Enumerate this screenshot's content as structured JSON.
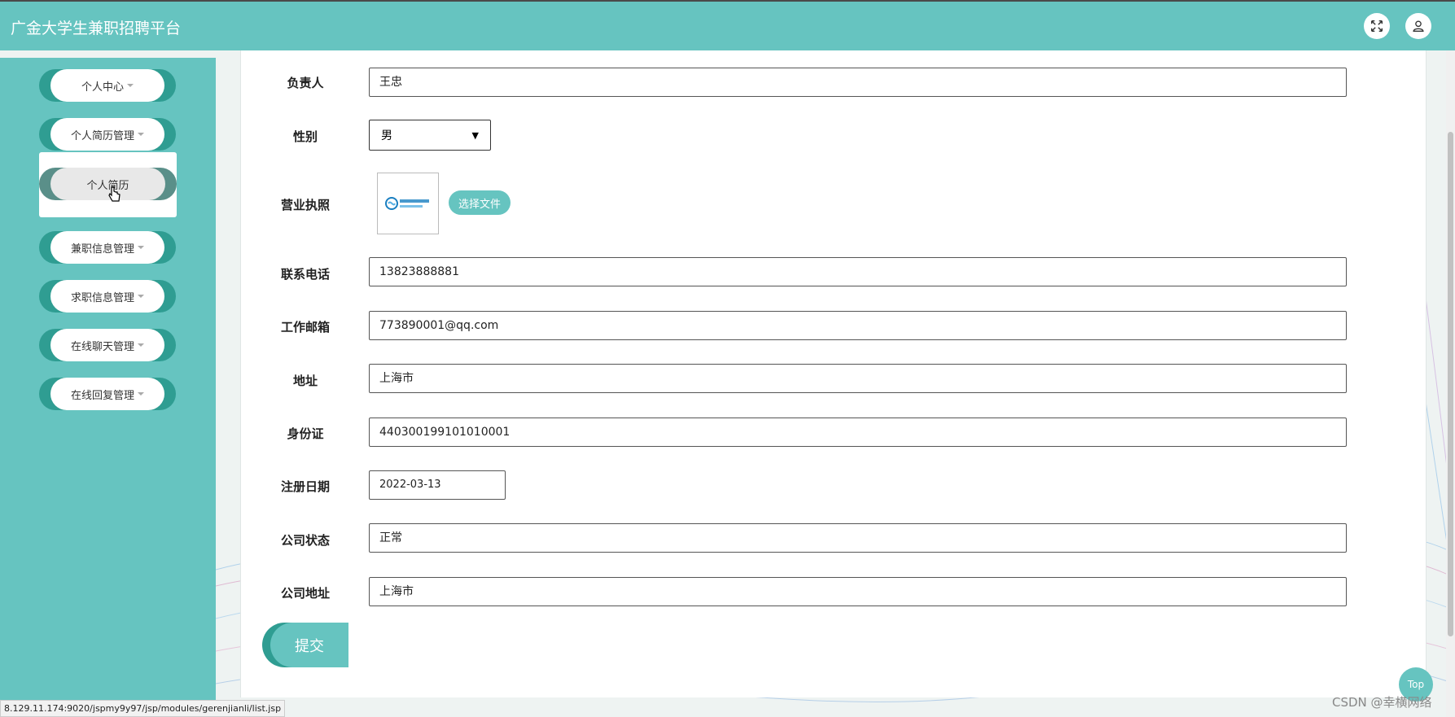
{
  "app": {
    "title": "广金大学生兼职招聘平台"
  },
  "header": {
    "fullscreen_icon": "expand-icon",
    "user_icon": "user-icon"
  },
  "sidebar": {
    "items": [
      {
        "label": "个人中心"
      },
      {
        "label": "个人简历管理"
      },
      {
        "label": "兼职信息管理"
      },
      {
        "label": "求职信息管理"
      },
      {
        "label": "在线聊天管理"
      },
      {
        "label": "在线回复管理"
      }
    ],
    "submenu": {
      "label": "个人简历"
    }
  },
  "form": {
    "fields": [
      {
        "label": "负责人",
        "value": "王忠"
      },
      {
        "label": "性别",
        "value": "男"
      },
      {
        "label": "营业执照",
        "button": "选择文件"
      },
      {
        "label": "联系电话",
        "value": "13823888881"
      },
      {
        "label": "工作邮箱",
        "value": "773890001@qq.com"
      },
      {
        "label": "地址",
        "value": "上海市"
      },
      {
        "label": "身份证",
        "value": "440300199101010001"
      },
      {
        "label": "注册日期",
        "value": "2022-03-13"
      },
      {
        "label": "公司状态",
        "value": "正常"
      },
      {
        "label": "公司地址",
        "value": "上海市"
      }
    ],
    "submit_label": "提交"
  },
  "status_bar": {
    "url": "8.129.11.174:9020/jspmy9y97/jsp/modules/gerenjianli/list.jsp"
  },
  "top_button": {
    "label": "Top"
  },
  "watermark": {
    "text": "CSDN @幸横网络"
  },
  "colors": {
    "accent": "#66c4c0",
    "accent_dark": "#2f9d92"
  }
}
